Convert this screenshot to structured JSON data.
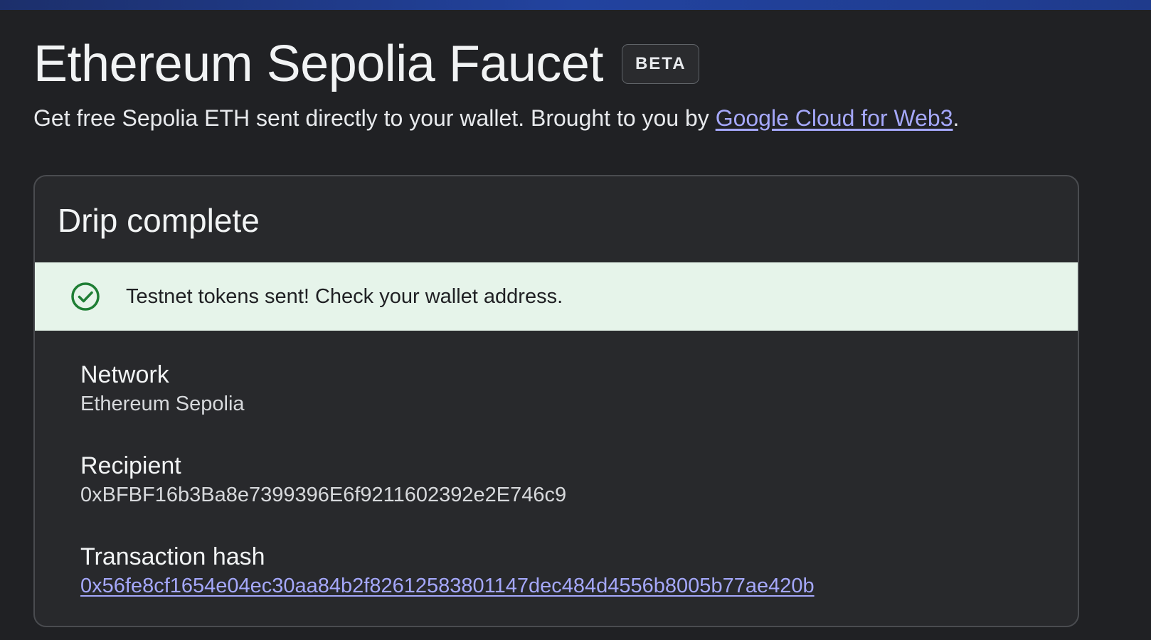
{
  "header": {
    "title": "Ethereum Sepolia Faucet",
    "badge": "BETA",
    "subtitle_prefix": "Get free Sepolia ETH sent directly to your wallet. Brought to you by ",
    "subtitle_link": "Google Cloud for Web3",
    "subtitle_suffix": "."
  },
  "card": {
    "title": "Drip complete",
    "banner": {
      "icon": "check-circle-icon",
      "message": "Testnet tokens sent! Check your wallet address.",
      "background": "#e6f4ea",
      "icon_color": "#1e7e34"
    },
    "details": [
      {
        "label": "Network",
        "value": "Ethereum Sepolia"
      },
      {
        "label": "Recipient",
        "value": "0xBFBF16b3Ba8e7399396E6f9211602392e2E746c9"
      },
      {
        "label": "Transaction hash",
        "value": "0x56fe8cf1654e04ec30aa84b2f82612583801147dec484d4556b8005b77ae420b"
      }
    ]
  },
  "colors": {
    "background": "#202124",
    "card": "#28292c",
    "link": "#a5a8fb",
    "top_bar": "#22439f"
  }
}
